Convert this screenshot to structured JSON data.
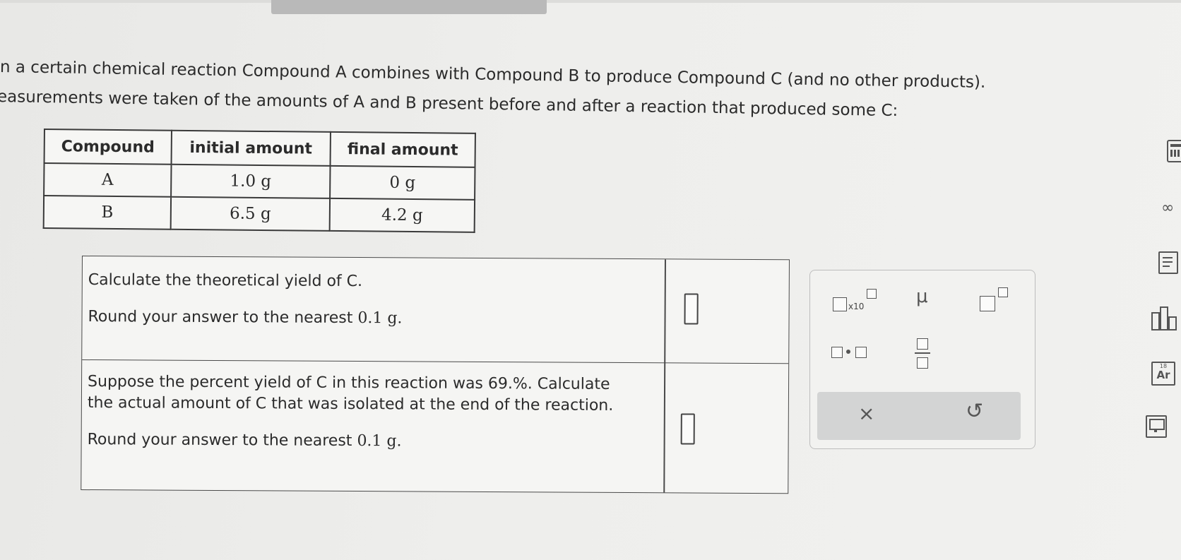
{
  "intro": {
    "line1": "n a certain chemical reaction Compound A combines with Compound B to produce Compound C (and no other products).",
    "line2": "easurements were taken of the amounts of A and B present before and after a reaction that produced some C:"
  },
  "table": {
    "headers": [
      "Compound",
      "initial amount",
      "final amount"
    ],
    "rows": [
      [
        "A",
        "1.0 g",
        "0 g"
      ],
      [
        "B",
        "6.5 g",
        "4.2 g"
      ]
    ]
  },
  "questions": [
    {
      "line1": "Calculate the theoretical yield of C.",
      "line2_prefix": "Round your answer to the nearest ",
      "line2_value": "0.1 g."
    },
    {
      "line1": "Suppose the percent yield of C in this reaction was 69.%. Calculate",
      "line1b": "the actual amount of C that was isolated at the end of the reaction.",
      "line2_prefix": "Round your answer to the nearest ",
      "line2_value": "0.1 g."
    }
  ],
  "toolpanel": {
    "sci_label": "x10",
    "mu": "μ",
    "clear": "×",
    "undo": "↺"
  },
  "sidebar": {
    "periodic_label_top": "18",
    "periodic_label": "Ar"
  },
  "icons": [
    "calculator-icon",
    "infinity-icon",
    "textbook-icon",
    "chart-icon",
    "periodic-table-icon",
    "reference-icon",
    "clear-icon",
    "undo-icon"
  ]
}
